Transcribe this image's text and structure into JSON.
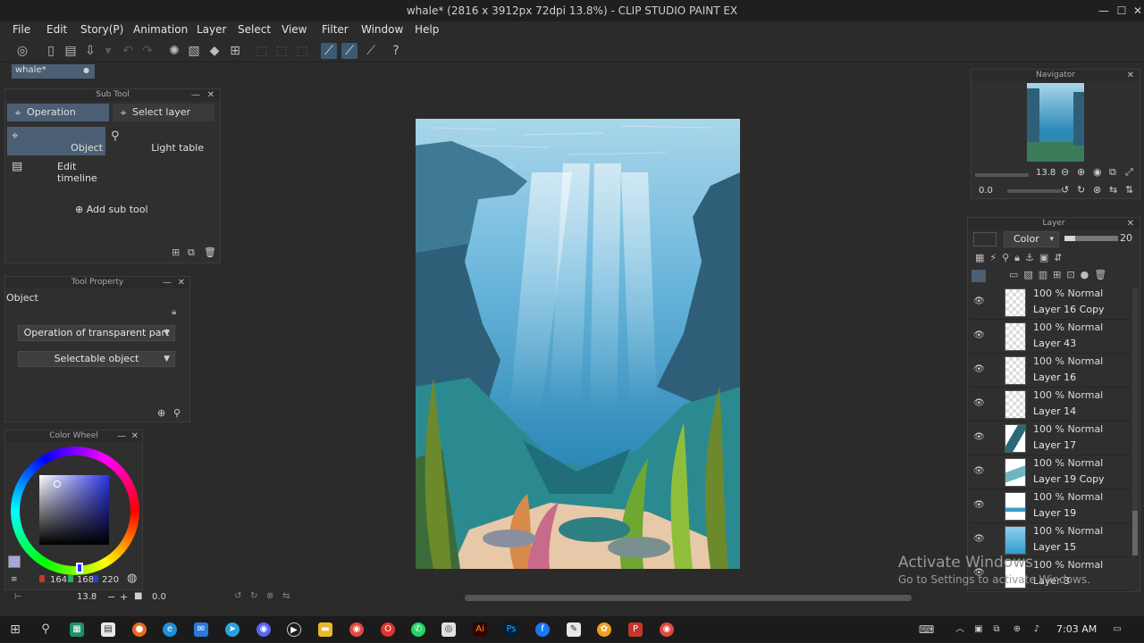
{
  "window": {
    "title": "whale* (2816 x 3912px 72dpi 13.8%) - CLIP STUDIO PAINT EX",
    "minimize": "—",
    "maximize": "☐",
    "close": "✕"
  },
  "menu": [
    "File",
    "Edit",
    "Story(P)",
    "Animation",
    "Layer",
    "Select",
    "View",
    "Filter",
    "Window",
    "Help"
  ],
  "document_tab": {
    "label": "whale*",
    "close": "●"
  },
  "sub_tool": {
    "title": "Sub Tool",
    "tabs": [
      {
        "label": "Operation",
        "active": true
      },
      {
        "label": "Select layer",
        "active": false
      }
    ],
    "items": [
      {
        "label": "Object",
        "selected": true
      },
      {
        "label": "Light table",
        "selected": false
      },
      {
        "label": "Edit timeline",
        "selected": false
      }
    ],
    "add_label": "Add sub tool"
  },
  "tool_property": {
    "title": "Tool Property",
    "heading": "Object",
    "options": [
      "Operation of transparent part",
      "Selectable object"
    ]
  },
  "color_wheel": {
    "title": "Color Wheel",
    "rgb": {
      "r": "164",
      "g": "168",
      "b": "220"
    },
    "main_color": "#a4a8dc"
  },
  "navigator": {
    "title": "Navigator",
    "zoom": "13.8",
    "rotation": "0.0"
  },
  "bottom_status": {
    "zoom": "13.8",
    "rotation": "0.0"
  },
  "layer_panel": {
    "title": "Layer",
    "blend_mode": "Color",
    "opacity": "20",
    "layers": [
      {
        "mode": "100 % Normal",
        "name": "Layer 16 Copy",
        "thumb": "checker"
      },
      {
        "mode": "100 % Normal",
        "name": "Layer 43",
        "thumb": "checker"
      },
      {
        "mode": "100 % Normal",
        "name": "Layer 16",
        "thumb": "checker"
      },
      {
        "mode": "100 % Normal",
        "name": "Layer 14",
        "thumb": "checker"
      },
      {
        "mode": "100 % Normal",
        "name": "Layer 17",
        "thumb": "teal"
      },
      {
        "mode": "100 % Normal",
        "name": "Layer 19 Copy",
        "thumb": "teal-light"
      },
      {
        "mode": "100 % Normal",
        "name": "Layer 19",
        "thumb": "blue-stripe"
      },
      {
        "mode": "100 % Normal",
        "name": "Layer 15",
        "thumb": "sky"
      },
      {
        "mode": "100 % Normal",
        "name": "Layer 3",
        "thumb": "white"
      }
    ]
  },
  "watermark": {
    "line1": "Activate Windows",
    "line2": "Go to Settings to activate Windows."
  },
  "taskbar": {
    "time": "7:03 AM"
  }
}
